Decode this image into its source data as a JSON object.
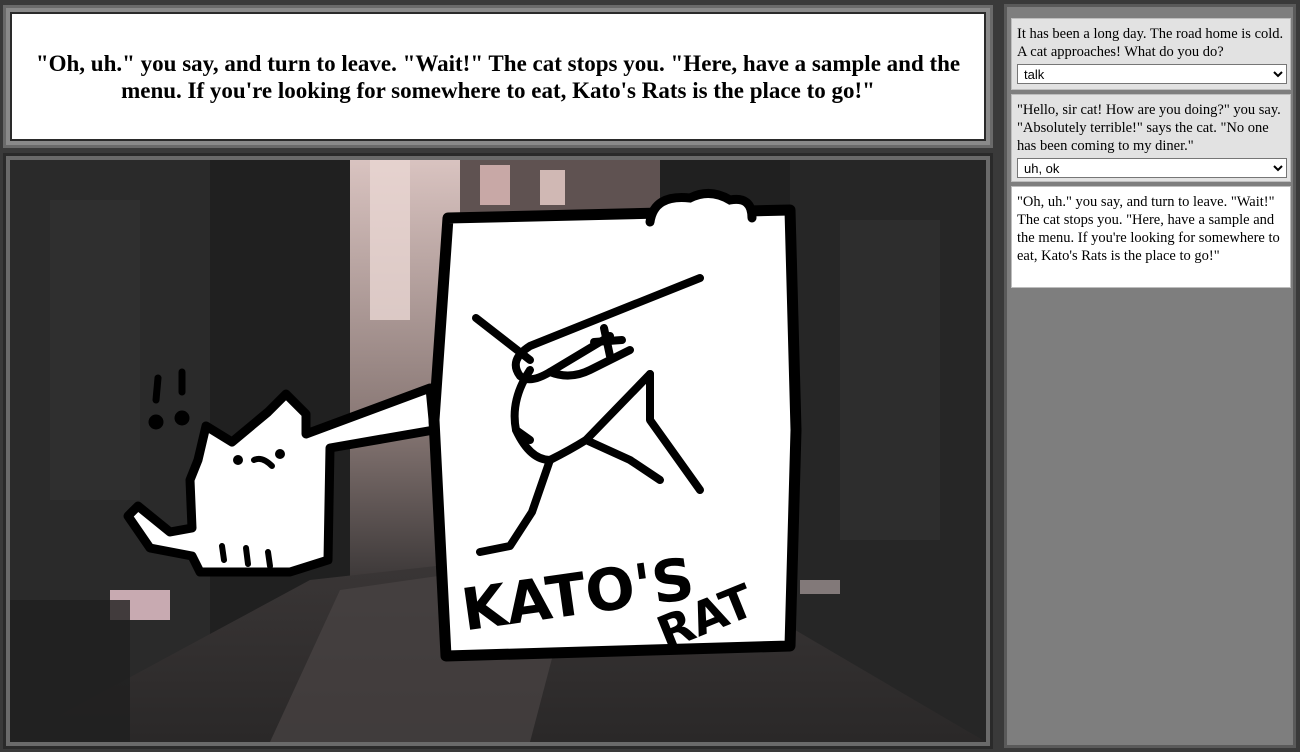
{
  "narration": {
    "text": "\"Oh, uh.\" you say, and turn to leave. \"Wait!\" The cat stops you. \"Here, have a sample and the menu. If you're looking for somewhere to eat, Kato's Rats is the place to go!\""
  },
  "scene": {
    "sign_line1": "KATO'S",
    "sign_line2": "RAT",
    "exclamation": "!!"
  },
  "history": [
    {
      "text": "It has been a long day. The road home is cold. A cat approaches! What do you do?",
      "choice": "talk"
    },
    {
      "text": "\"Hello, sir cat! How are you doing?\" you say. \"Absolutely terrible!\" says the cat. \"No one has been coming to my diner.\"",
      "choice": "uh, ok"
    },
    {
      "text": "\"Oh, uh.\" you say, and turn to leave. \"Wait!\" The cat stops you. \"Here, have a sample and the menu. If you're looking for somewhere to eat, Kato's Rats is the place to go!\""
    }
  ],
  "colors": {
    "background": "#3a3a3a",
    "panel": "#7e7e7e",
    "past_entry": "#e2e2e2",
    "current_entry": "#ffffff"
  }
}
